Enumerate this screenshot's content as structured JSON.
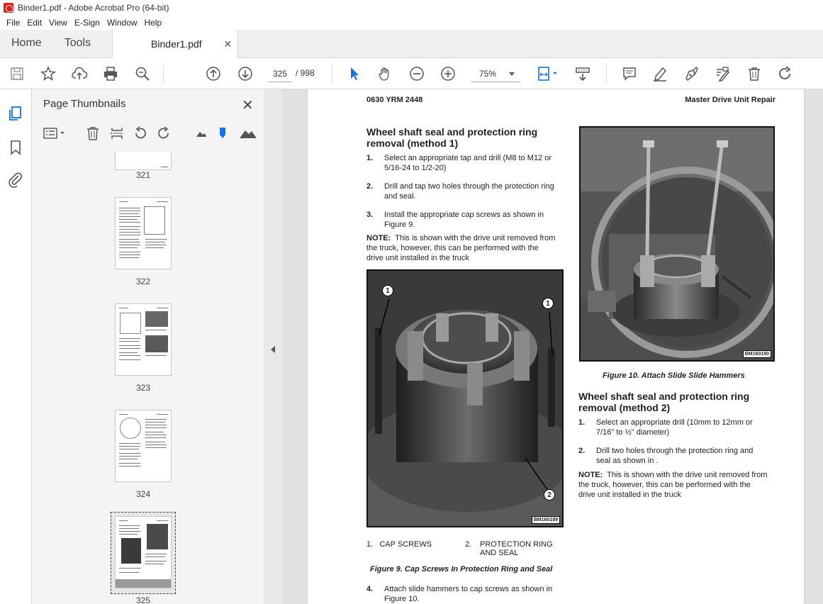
{
  "window": {
    "title": "Binder1.pdf - Adobe Acrobat Pro (64-bit)"
  },
  "menu": [
    "File",
    "Edit",
    "View",
    "E-Sign",
    "Window",
    "Help"
  ],
  "tabs": {
    "home": "Home",
    "tools": "Tools",
    "document": "Binder1.pdf"
  },
  "toolbar": {
    "current_page": "325",
    "total_pages": "/ 998",
    "zoom": "75%"
  },
  "thumbnails": {
    "title": "Page Thumbnails",
    "pages": [
      "321",
      "322",
      "323",
      "324",
      "325"
    ]
  },
  "document": {
    "header_left": "0630 YRM 2448",
    "header_right": "Master Drive Unit Repair",
    "section1": {
      "title_line1": "Wheel shaft seal and protection ring",
      "title_line2": "removal (method 1)",
      "steps": [
        {
          "num": "1.",
          "line1": "Select an appropriate tap and drill (M8 to M12 or",
          "line2": "5/16-24 to 1/2-20)"
        },
        {
          "num": "2.",
          "line1": "Drill and tap two holes through the protection ring",
          "line2": "and seal."
        },
        {
          "num": "3.",
          "line1": "Install the appropriate cap screws as shown in",
          "line2": "Figure 9."
        }
      ],
      "note_label": "NOTE:",
      "note_line1": "This is shown with the drive unit removed from",
      "note_line2": "the truck, however, this can be performed with the",
      "note_line3": "drive unit installed in the truck"
    },
    "figure9": {
      "code": "BM160189",
      "callout1": "1",
      "callout2": "2",
      "legend1_num": "1.",
      "legend1": "CAP SCREWS",
      "legend2_num": "2.",
      "legend2_line1": "PROTECTION RING",
      "legend2_line2": "AND SEAL",
      "caption": "Figure 9. Cap Screws In Protection Ring and Seal"
    },
    "step4": {
      "num": "4.",
      "line1": "Attach slide hammers to cap screws as shown in",
      "line2": "Figure 10."
    },
    "figure10": {
      "code": "BM160190",
      "caption": "Figure 10. Attach Slide Slide Hammers"
    },
    "section2": {
      "title_line1": "Wheel shaft seal and protection ring",
      "title_line2": "removal (method 2)",
      "steps": [
        {
          "num": "1.",
          "line1": "Select an appropriate drill (10mm to 12mm or",
          "line2": "7/16\" to ½\" diameter)"
        },
        {
          "num": "2.",
          "line1": "Drill two holes through the protection ring and",
          "line2": "seal as shown in ."
        }
      ],
      "note_label": "NOTE:",
      "note_line1": "This is shown with the drive unit removed from",
      "note_line2": "the truck, however, this can be performed with the",
      "note_line3": "drive unit installed in the truck"
    }
  }
}
